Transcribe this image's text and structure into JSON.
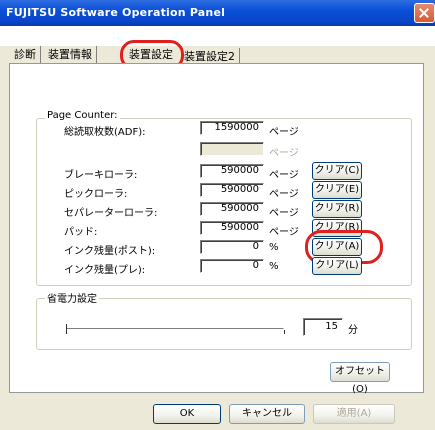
{
  "window": {
    "title": "FUJITSU Software Operation Panel"
  },
  "tabs": [
    {
      "label": "診断"
    },
    {
      "label": "装置情報"
    },
    {
      "label": "装置設定"
    },
    {
      "label": "装置設定2"
    }
  ],
  "page_counter": {
    "legend": "Page Counter:",
    "rows": [
      {
        "label": "総読取枚数(ADF):",
        "value": "1590000",
        "unit": "ページ"
      },
      {
        "label": "",
        "value": "",
        "unit": "ページ"
      },
      {
        "label": "ブレーキローラ:",
        "value": "590000",
        "unit": "ページ",
        "button": "クリア(C)"
      },
      {
        "label": "ピックローラ:",
        "value": "590000",
        "unit": "ページ",
        "button": "クリア(E)"
      },
      {
        "label": "セパレーターローラ:",
        "value": "590000",
        "unit": "ページ",
        "button": "クリア(R)"
      },
      {
        "label": "パッド:",
        "value": "590000",
        "unit": "ページ",
        "button": "クリア(R)"
      },
      {
        "label": "インク残量(ポスト):",
        "value": "0",
        "unit": "%",
        "button": "クリア(A)"
      },
      {
        "label": "インク残量(プレ):",
        "value": "0",
        "unit": "%",
        "button": "クリア(L)"
      }
    ]
  },
  "power_saving": {
    "legend": "省電力設定",
    "value": "15",
    "unit": "分"
  },
  "offset_button": "オフセット(O)",
  "footer": {
    "ok": "OK",
    "cancel": "キャンセル",
    "apply": "適用(A)"
  },
  "colors": {
    "title_bar": "#0a4fd8",
    "highlight_ring": "#e0201e",
    "dialog_bg": "#ece9d8"
  }
}
